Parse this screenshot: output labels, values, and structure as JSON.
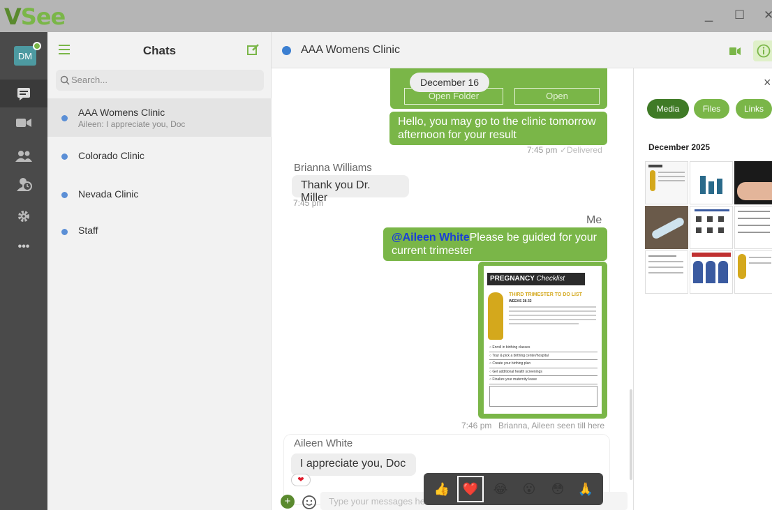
{
  "app": {
    "logo_v": "V",
    "logo_see": "See"
  },
  "window": {
    "minimize": "_",
    "maximize": "☐",
    "close": "✕"
  },
  "rail": {
    "avatar_initials": "DM"
  },
  "chatlist": {
    "title": "Chats",
    "search_placeholder": "Search...",
    "items": [
      {
        "name": "AAA Womens Clinic",
        "preview": "Aileen: I appreciate you, Doc"
      },
      {
        "name": "Colorado Clinic",
        "preview": ""
      },
      {
        "name": "Nevada Clinic",
        "preview": ""
      },
      {
        "name": "Staff",
        "preview": ""
      }
    ]
  },
  "conversation": {
    "title": "AAA Womens Clinic",
    "date_badge": "December 16",
    "open_folder_label": "Open Folder",
    "open_label": "Open",
    "msg1": {
      "text": "Hello, you may go to the clinic tomorrow afternoon for your result",
      "time": "7:45 pm",
      "status": "✓Delivered"
    },
    "msg2": {
      "sender": "Brianna Williams",
      "text": "Thank you Dr. Miller",
      "time": "7:45 pm"
    },
    "msg3": {
      "sender": "Me",
      "mention": "@Aileen White",
      "text": "Please be guided for your current trimester"
    },
    "image_doc": {
      "title": "PREGNANCY",
      "title_script": "Checklist",
      "subtitle": "THIRD TRIMESTER TO DO LIST",
      "weeks": "WEEKS 28-32",
      "items": [
        "Enroll in birthing classes",
        "Tour & pick a birthing center/hospital",
        "Create your birthing plan",
        "Get additional health screenings",
        "Finalize your maternity leave"
      ]
    },
    "msg4_meta": {
      "time": "7:46 pm",
      "seen": "Brianna, Aileen seen till here"
    },
    "msg5": {
      "sender": "Aileen White",
      "text": "I appreciate you, Doc",
      "reaction": "❤"
    },
    "composer_placeholder": "Type your messages here"
  },
  "infopanel": {
    "tabs": [
      "Media",
      "Files",
      "Links"
    ],
    "section_title": "December 2025",
    "close": "×"
  },
  "colors": {
    "brand_green": "#7ab648",
    "dark_green": "#4e8a2c",
    "rail": "#4a4a4a"
  },
  "reactions": [
    "👍",
    "❤️",
    "😂",
    "😮",
    "😳",
    "🙏"
  ]
}
